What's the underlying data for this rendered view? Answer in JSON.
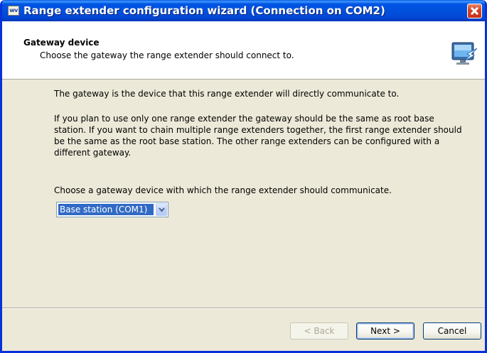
{
  "window": {
    "title": "Range extender configuration wizard (Connection on COM2)",
    "app_icon_text": "wv"
  },
  "header": {
    "title": "Gateway device",
    "subtitle": "Choose the gateway the range extender should connect to.",
    "graphic_icon": "connection-wizard-icon"
  },
  "body": {
    "paragraph1": "The gateway is the device that this range extender will directly communicate to.",
    "paragraph2": "If you plan to use only one range extender the gateway should be the same as root base station. If you want to chain multiple range extenders together, the first range extender should be the same as the root base station. The other range extenders can be configured with a different gateway.",
    "prompt": "Choose a gateway device with which the range extender should communicate.",
    "gateway_select": {
      "selected": "Base station (COM1)"
    }
  },
  "buttons": {
    "back": "< Back",
    "next": "Next >",
    "cancel": "Cancel"
  },
  "colors": {
    "titlebar": "#0054e3",
    "dialog_bg": "#ece9d8",
    "selection": "#316ac5"
  }
}
